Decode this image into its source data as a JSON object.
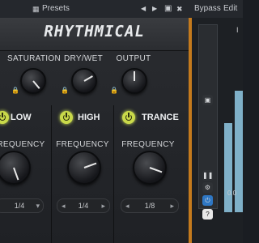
{
  "topbar": {
    "presets_label": "Presets",
    "bypass_label": "Bypass",
    "edit_label": "Edit"
  },
  "plugin": {
    "title": "RHYTHMICAL",
    "global": {
      "saturation": "SATURATION",
      "drywet": "DRY/WET",
      "output": "OUTPUT"
    },
    "bands": [
      {
        "name": "LOW",
        "freq_label": "FREQUENCY",
        "rate": "1/4"
      },
      {
        "name": "HIGH",
        "freq_label": "FREQUENCY",
        "rate": "1/4"
      },
      {
        "name": "TRANCE",
        "freq_label": "FREQUENCY",
        "rate": "1/8"
      }
    ]
  },
  "side": {
    "scale_top": "I",
    "scale_bottom": "0.0",
    "meter_levels": [
      0.55,
      0.75
    ]
  },
  "colors": {
    "accent": "#c47a1d",
    "power": "#c9d94a",
    "meter": "#7fb0c8"
  }
}
